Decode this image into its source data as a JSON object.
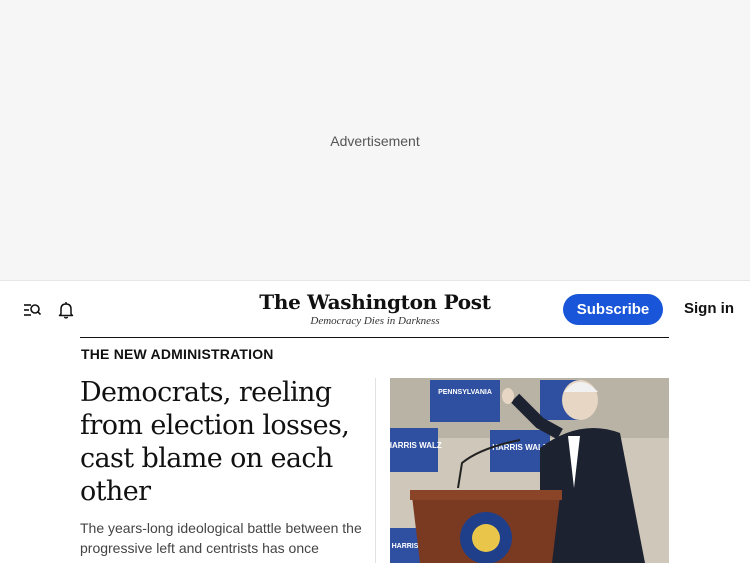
{
  "ad": {
    "label": "Advertisement"
  },
  "header": {
    "logo_name": "The Washington Post",
    "logo_tagline": "Democracy Dies in Darkness",
    "subscribe_label": "Subscribe",
    "signin_label": "Sign in",
    "icons": [
      "search-menu-icon",
      "bell-icon"
    ]
  },
  "story": {
    "kicker": "THE NEW ADMINISTRATION",
    "headline": "Democrats, reeling from election losses, cast blame on each other",
    "dek": "The years-long ideological battle between the progressive left and centrists has once",
    "photo_signs": [
      "PENNSYLVANIA",
      "HARRIS WALZ",
      "HARRIS WALZ",
      "HARRIS"
    ]
  },
  "colors": {
    "accent": "#1955d8",
    "ad_background": "#f6f6f6",
    "text": "#111111"
  }
}
